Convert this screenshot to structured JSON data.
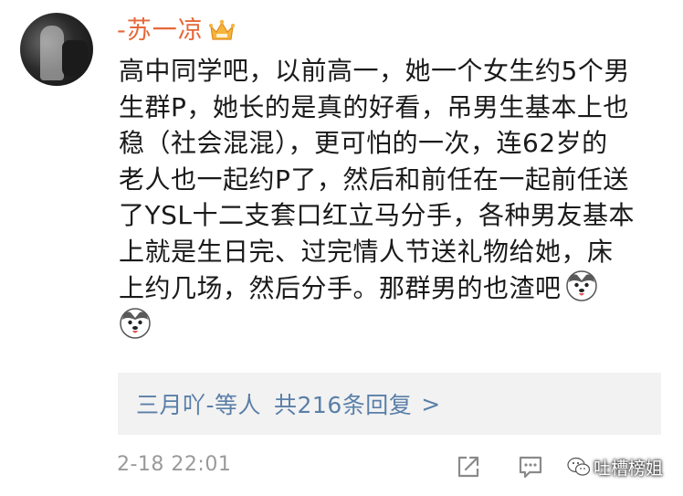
{
  "comment": {
    "username": "-苏一凉",
    "username_color": "#e5683a",
    "vip_icon": "crown-icon",
    "lines": [
      "高中同学吧，以前高一，她一个女生约5个男",
      "生群P，她长的是真的好看，吊男生基本上也",
      "稳（社会混混），更可怕的一次，连62岁的",
      "老人也一起约P了，然后和前任在一起前任送",
      "了YSL十二支套口红立马分手，各种男友基本",
      "上就是生日完、过完情人节送礼物给她，床",
      "上约几场，然后分手。那群男的也渣吧"
    ],
    "emojis": [
      "husky-emoji",
      "husky-emoji"
    ],
    "timestamp": "2-18 22:01"
  },
  "replies": {
    "users_text": "三月吖-等人",
    "count_text": "共216条回复",
    "arrow": ">",
    "link_color": "#5a7fa8"
  },
  "actions": {
    "share_icon": "share-icon",
    "comment_icon": "comment-icon"
  },
  "watermark": {
    "text": "吐槽榜姐",
    "icon": "wechat-icon"
  }
}
